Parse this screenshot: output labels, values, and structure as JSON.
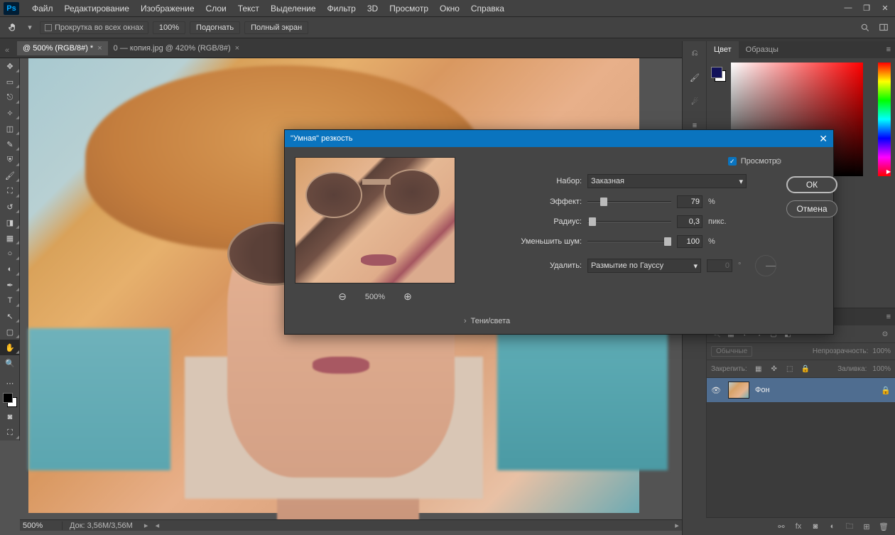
{
  "app": {
    "logo": "Ps"
  },
  "menu": {
    "items": [
      "Файл",
      "Редактирование",
      "Изображение",
      "Слои",
      "Текст",
      "Выделение",
      "Фильтр",
      "3D",
      "Просмотр",
      "Окно",
      "Справка"
    ]
  },
  "optbar": {
    "scroll_all": "Прокрутка во всех окнах",
    "zoom": "100%",
    "fit": "Подогнать",
    "fullscreen": "Полный экран"
  },
  "tabs": {
    "items": [
      {
        "label": "@ 500% (RGB/8#) *",
        "active": true
      },
      {
        "label": "0 — копия.jpg @ 420% (RGB/8#)",
        "active": false
      }
    ]
  },
  "panels": {
    "color_tabs": [
      "Цвет",
      "Образцы"
    ],
    "layers": {
      "blend_mode": "Обычные",
      "opacity_label": "Непрозрачность:",
      "opacity": "100%",
      "lock_label": "Закрепить:",
      "fill_label": "Заливка:",
      "fill": "100%",
      "items": [
        {
          "name": "Фон"
        }
      ]
    }
  },
  "dialog": {
    "title": "\"Умная\" резкость",
    "preview_label": "Просмотр",
    "set_label": "Набор:",
    "set_value": "Заказная",
    "amount_label": "Эффект:",
    "amount_value": "79",
    "amount_unit": "%",
    "radius_label": "Радиус:",
    "radius_value": "0,3",
    "radius_unit": "пикс.",
    "noise_label": "Уменьшить шум:",
    "noise_value": "100",
    "noise_unit": "%",
    "remove_label": "Удалить:",
    "remove_value": "Размытие по Гауссу",
    "angle_value": "0",
    "angle_unit": "°",
    "shadows_label": "Тени/света",
    "zoom": "500%",
    "ok": "ОК",
    "cancel": "Отмена"
  },
  "status": {
    "zoom": "500%",
    "docinfo": "Док: 3,56M/3,56M"
  }
}
